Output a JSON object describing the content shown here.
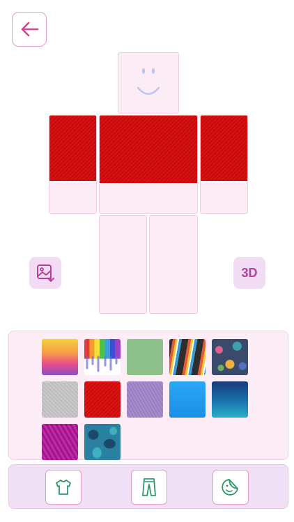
{
  "toolbar": {
    "back_icon": "arrow-left-icon",
    "accent": "#d0478f"
  },
  "avatar": {
    "face_icon": "smiley-face",
    "shirt_color": "#d20a0a",
    "skin_color": "#fcecf6"
  },
  "side_buttons": {
    "export_icon": "image-download-icon",
    "view3d_label": "3D"
  },
  "palette": {
    "swatches": [
      "pink-yellow-watercolor",
      "rainbow-paint-drips",
      "sage-green",
      "colorful-lightning-stripes",
      "paisley-pattern",
      "grey-fabric",
      "red-fabric",
      "purple-knit",
      "bright-blue",
      "blue-hex-gradient",
      "magenta-chevron",
      "teal-camo"
    ]
  },
  "tabs": [
    {
      "name": "shirt",
      "icon": "shirt-icon"
    },
    {
      "name": "pants",
      "icon": "pants-icon"
    },
    {
      "name": "face",
      "icon": "face-sticker-icon"
    }
  ]
}
